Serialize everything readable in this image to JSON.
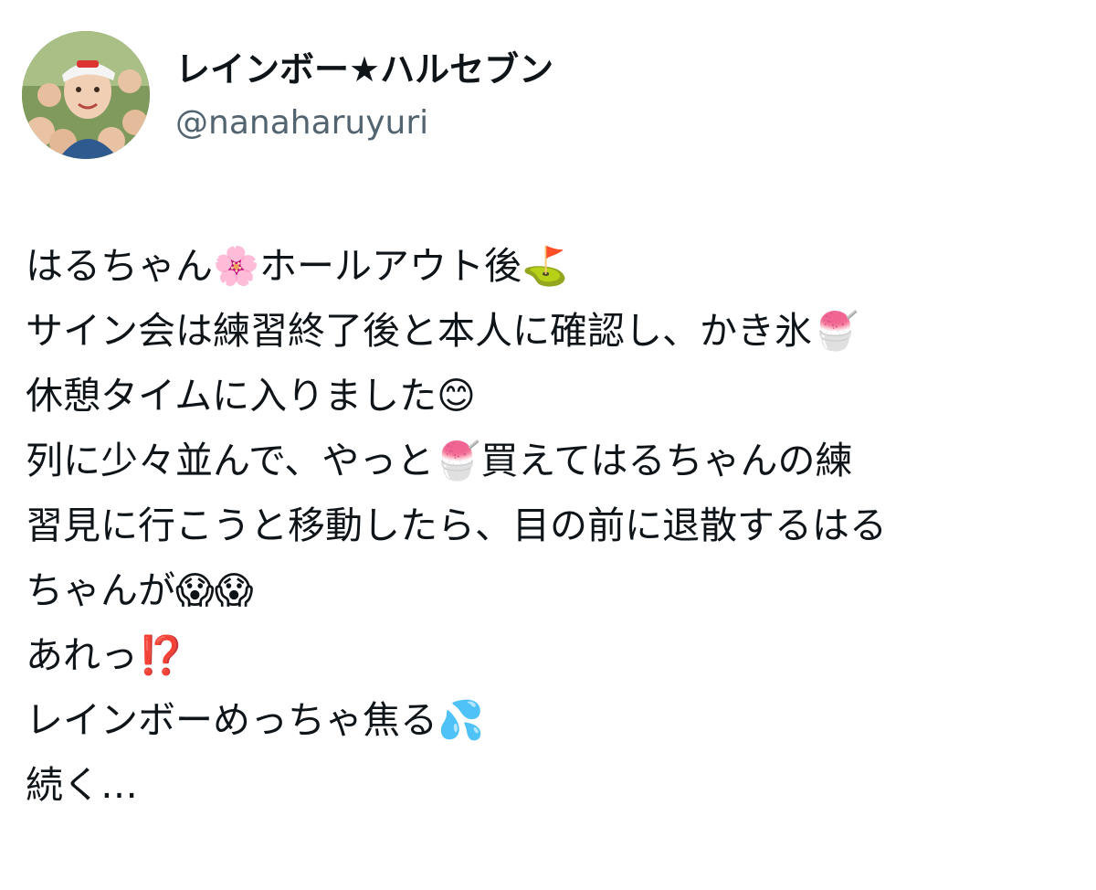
{
  "author": {
    "display_name": "レインボー★ハルセブン",
    "handle": "@nanaharuyuri",
    "avatar_icon": "avatar-photo-icon"
  },
  "tweet": {
    "lines": [
      "はるちゃん🌸ホールアウト後⛳️",
      "サイン会は練習終了後と本人に確認し、かき氷🍧",
      "休憩タイムに入りました😊",
      "列に少々並んで、やっと🍧買えてはるちゃんの練",
      "習見に行こうと移動したら、目の前に退散するはる",
      "ちゃんが😱😱",
      "あれっ⁉️",
      "レインボーめっちゃ焦る💦",
      "続く…"
    ]
  },
  "colors": {
    "text": "#0f1419",
    "secondary": "#536471",
    "background": "#ffffff"
  }
}
